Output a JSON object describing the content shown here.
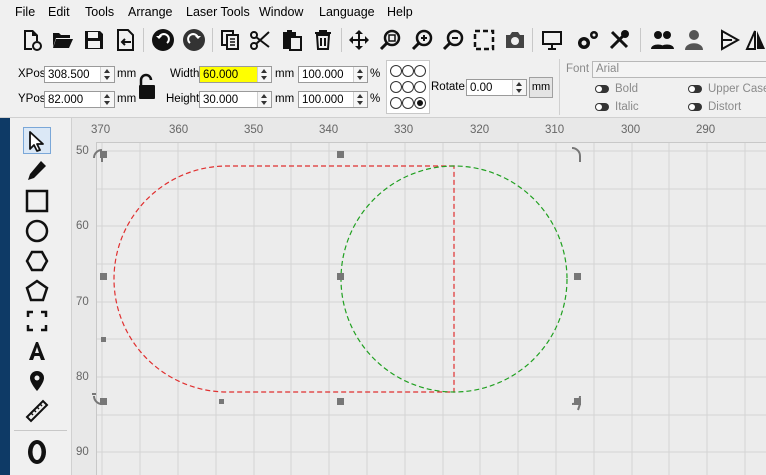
{
  "menu": [
    "File",
    "Edit",
    "Tools",
    "Arrange",
    "Laser Tools",
    "Window",
    "Language",
    "Help"
  ],
  "props": {
    "xpos_label": "XPos",
    "xpos_value": "308.500",
    "ypos_label": "YPos",
    "ypos_value": "82.000",
    "unit": "mm",
    "width_label": "Width",
    "width_value": "60.000",
    "height_label": "Height",
    "height_value": "30.000",
    "scale_w": "100.000",
    "scale_h": "100.000",
    "percent": "%",
    "rotate_label": "Rotate",
    "rotate_value": "0.00",
    "rotate_unit": "mm"
  },
  "font": {
    "label": "Font",
    "value": "Arial",
    "bold": "Bold",
    "italic": "Italic",
    "upper_case": "Upper Case",
    "distort": "Distort"
  },
  "ruler": {
    "top": [
      "370",
      "360",
      "350",
      "340",
      "330",
      "320",
      "310",
      "300",
      "290"
    ],
    "left": [
      "50",
      "60",
      "70",
      "80",
      "90"
    ]
  },
  "colors": {
    "selection_red": "#e03030",
    "shape_green": "#20a020",
    "sidebar": "#0e3a66",
    "highlight": "#ffff00"
  }
}
